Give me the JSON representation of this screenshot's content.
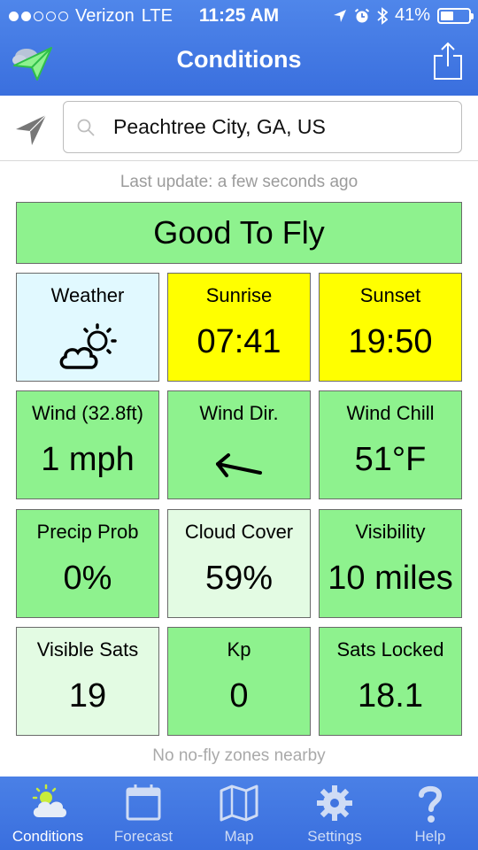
{
  "status_bar": {
    "carrier": "Verizon",
    "network": "LTE",
    "time": "11:25 AM",
    "battery": "41%",
    "battery_level": 0.41,
    "signal_bars": 2,
    "signal_total": 5
  },
  "header": {
    "title": "Conditions",
    "logo_icon": "paper-plane-cloud-icon",
    "share_icon": "share-icon"
  },
  "search": {
    "location_icon": "location-arrow-icon",
    "search_icon": "search-icon",
    "value": "Peachtree City, GA, US"
  },
  "last_update": "Last update: a few seconds ago",
  "banner": {
    "text": "Good To Fly",
    "color": "#8ef28e"
  },
  "tiles": [
    {
      "label": "Weather",
      "value": "",
      "icon": "partly-cloudy-icon",
      "color": "#e1f9ff"
    },
    {
      "label": "Sunrise",
      "value": "07:41",
      "color": "#ffff00"
    },
    {
      "label": "Sunset",
      "value": "19:50",
      "color": "#ffff00"
    },
    {
      "label": "Wind (32.8ft)",
      "value": "1 mph",
      "color": "#8ef28e"
    },
    {
      "label": "Wind Dir.",
      "value": "",
      "icon": "arrow-left-icon",
      "color": "#8ef28e"
    },
    {
      "label": "Wind Chill",
      "value": "51°F",
      "color": "#8ef28e"
    },
    {
      "label": "Precip Prob",
      "value": "0%",
      "color": "#8ef28e"
    },
    {
      "label": "Cloud Cover",
      "value": "59%",
      "color": "#e3fbe3"
    },
    {
      "label": "Visibility",
      "value": "10 miles",
      "color": "#8ef28e"
    },
    {
      "label": "Visible Sats",
      "value": "19",
      "color": "#e3fbe3"
    },
    {
      "label": "Kp",
      "value": "0",
      "color": "#8ef28e"
    },
    {
      "label": "Sats Locked",
      "value": "18.1",
      "color": "#8ef28e"
    }
  ],
  "nofly_text": "No no-fly zones nearby",
  "tabs": [
    {
      "label": "Conditions",
      "icon": "partly-cloudy-icon",
      "active": true
    },
    {
      "label": "Forecast",
      "icon": "calendar-icon",
      "active": false
    },
    {
      "label": "Map",
      "icon": "map-icon",
      "active": false
    },
    {
      "label": "Settings",
      "icon": "gear-icon",
      "active": false
    },
    {
      "label": "Help",
      "icon": "question-mark-icon",
      "active": false
    }
  ]
}
